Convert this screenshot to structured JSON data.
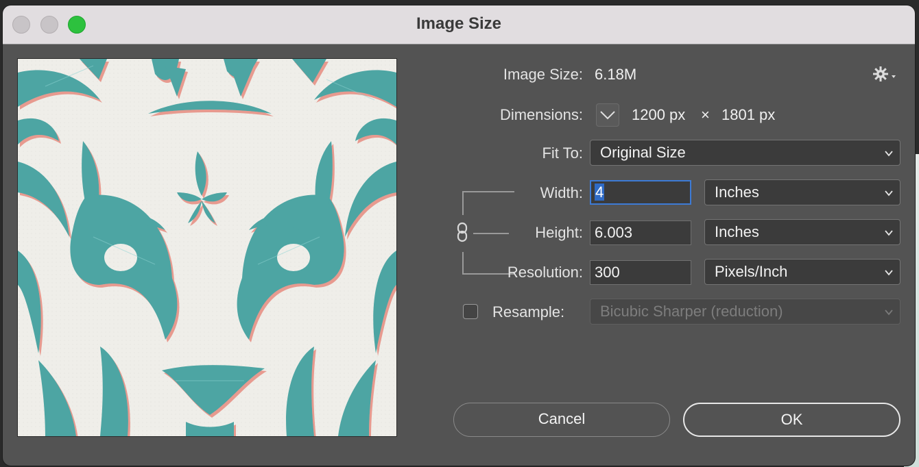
{
  "window": {
    "title": "Image Size"
  },
  "colors": {
    "teal": "#4ea5a3",
    "paper": "#efeee9",
    "shadow_pink": "#e79a8f",
    "focus_blue": "#3d7bd6"
  },
  "info": {
    "image_size_label": "Image Size:",
    "image_size_value": "6.18M",
    "dimensions_label": "Dimensions:",
    "dim_width": "1200 px",
    "dim_times": "×",
    "dim_height": "1801 px"
  },
  "fit_to": {
    "label": "Fit To:",
    "value": "Original Size"
  },
  "width": {
    "label": "Width:",
    "value": "4",
    "unit": "Inches"
  },
  "height": {
    "label": "Height:",
    "value": "6.003",
    "unit": "Inches"
  },
  "resolution": {
    "label": "Resolution:",
    "value": "300",
    "unit": "Pixels/Inch"
  },
  "resample": {
    "label": "Resample:",
    "checked": false,
    "method": "Bicubic Sharper (reduction)"
  },
  "buttons": {
    "cancel": "Cancel",
    "ok": "OK"
  },
  "icons": {
    "settings": "gear-icon",
    "dimensions_menu": "chevron-down-icon",
    "constrain": "link-icon"
  }
}
